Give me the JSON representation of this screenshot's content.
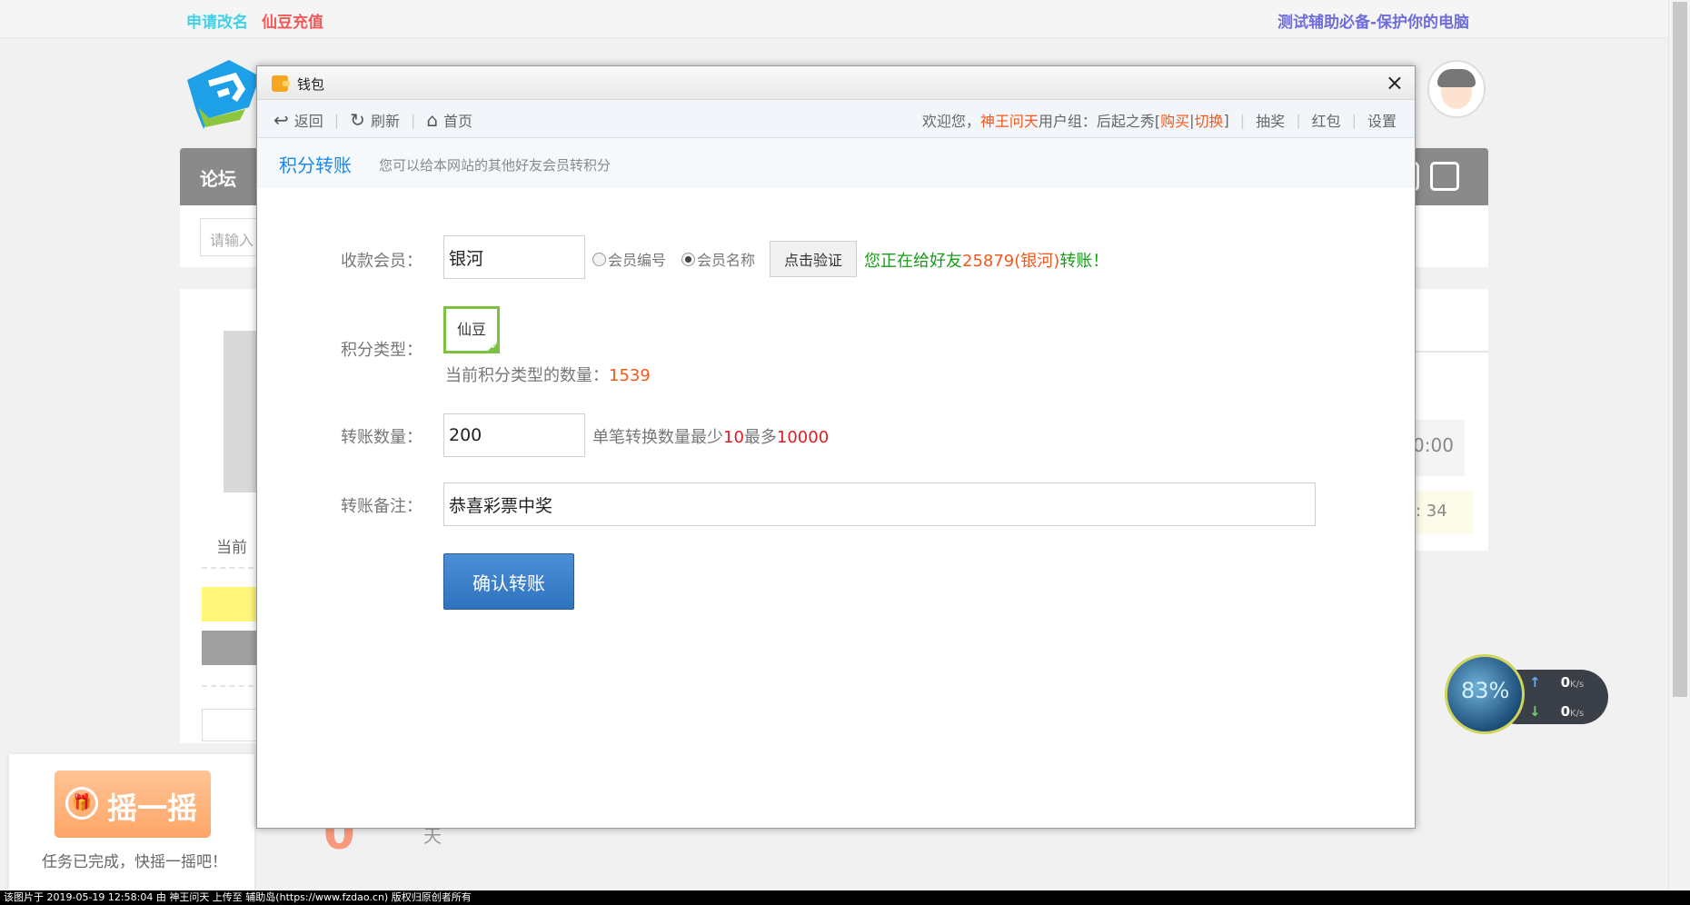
{
  "topbar": {
    "rename": "申请改名",
    "recharge": "仙豆充值",
    "protect": "测试辅助必备-保护你的电脑"
  },
  "forum": {
    "nav_title": "论坛",
    "search_placeholder": "请输入",
    "current_label": "当前",
    "time_fragment": "0:00",
    "num_fragment": ": 34",
    "day_label": "天",
    "counter": "0"
  },
  "shake": {
    "button_label": "摇一摇",
    "tip": "任务已完成，快摇一摇吧！"
  },
  "network": {
    "percent": "83%",
    "up_value": "0",
    "down_value": "0",
    "unit": "K/s"
  },
  "footer": {
    "text": "该图片于 2019-05-19 12:58:04 由 神王问天 上传至 辅助岛(https://www.fzdao.cn) 版权归原创者所有"
  },
  "dialog": {
    "title": "钱包",
    "close": "×",
    "toolbar": {
      "back": "返回",
      "refresh": "刷新",
      "home": "首页",
      "welcome": "欢迎您，",
      "username": "神王问天",
      "group_label": " 用户组：后起之秀[ ",
      "buy": "购买",
      "bar": "|",
      "switch": "切换",
      "group_end": " ]",
      "lottery": "抽奖",
      "redpacket": "红包",
      "settings": "设置"
    },
    "section": {
      "title": "积分转账",
      "desc": "您可以给本网站的其他好友会员转积分"
    },
    "form": {
      "recipient_label": "收款会员：",
      "recipient_value": "银河",
      "radio_id": "会员编号",
      "radio_name": "会员名称",
      "selected_radio": "会员名称",
      "verify_button": "点击验证",
      "verify_msg_prefix": "您正在给好友",
      "verify_msg_target": "25879(银河)",
      "verify_msg_suffix": "转账！",
      "credit_type_label": "积分类型：",
      "credit_type_option": "仙豆",
      "credit_count_label": "当前积分类型的数量：",
      "credit_count_value": "1539",
      "amount_label": "转账数量：",
      "amount_value": "200",
      "amount_hint_prefix": "单笔转换数量最少",
      "amount_min": "10",
      "amount_hint_mid": "最多",
      "amount_max": "10000",
      "note_label": "转账备注：",
      "note_value": "恭喜彩票中奖",
      "confirm_button": "确认转账"
    }
  },
  "colors": {
    "accent_blue": "#1e88e5",
    "highlight_orange": "#f2581a",
    "success_green": "#1a9b1a",
    "limit_red": "#e51c23",
    "selected_green": "#7cc142"
  }
}
